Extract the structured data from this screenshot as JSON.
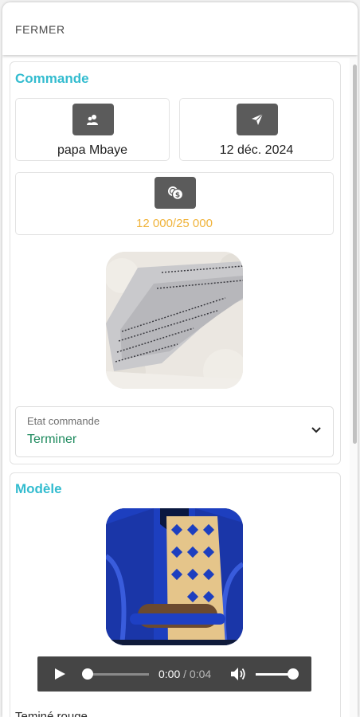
{
  "topbar": {
    "close_label": "FERMER"
  },
  "order": {
    "section_title": "Commande",
    "customer": {
      "icon": "users-icon",
      "name": "papa Mbaye"
    },
    "date": {
      "icon": "send-icon",
      "value": "12 déc. 2024"
    },
    "payment": {
      "icon": "coins-icon",
      "amount": "12 000/25 000"
    },
    "fabric_image": "fabric-photo",
    "status": {
      "label": "Etat commande",
      "value": "Terminer"
    }
  },
  "model": {
    "section_title": "Modèle",
    "image": "boubou-photo",
    "audio": {
      "current": "0:00",
      "separator": "/",
      "duration": "0:04"
    }
  },
  "footer_text": "Teminé rouge",
  "colors": {
    "accent": "#33bccf",
    "amount": "#f0b33a",
    "status": "#1e8a5e",
    "icon_bg": "#5b5b5b"
  }
}
